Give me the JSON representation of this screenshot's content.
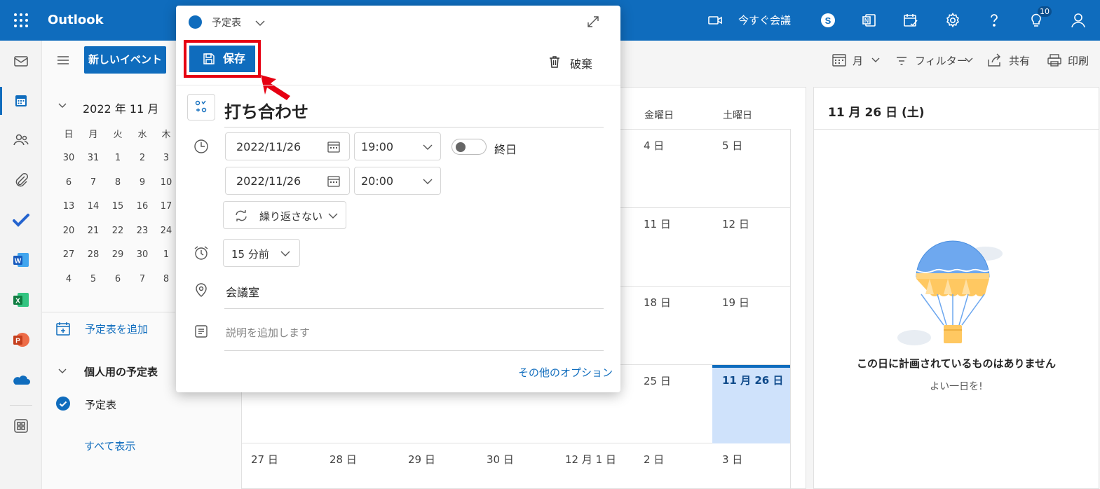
{
  "app": {
    "name": "Outlook"
  },
  "topbar": {
    "meet_now": "今すぐ会議",
    "notification_count": "10"
  },
  "toolbar": {
    "new_event": "新しいイベント",
    "view": "月",
    "filter": "フィルター",
    "share": "共有",
    "print": "印刷"
  },
  "mini_calendar": {
    "month": "2022 年 11 月",
    "weekdays": [
      "日",
      "月",
      "火",
      "水",
      "木"
    ],
    "weeks": [
      [
        "30",
        "31",
        "1",
        "2",
        "3"
      ],
      [
        "6",
        "7",
        "8",
        "9",
        "10"
      ],
      [
        "13",
        "14",
        "15",
        "16",
        "17"
      ],
      [
        "20",
        "21",
        "22",
        "23",
        "24"
      ],
      [
        "27",
        "28",
        "29",
        "30",
        "1"
      ],
      [
        "4",
        "5",
        "6",
        "7",
        "8"
      ]
    ]
  },
  "left_pane": {
    "add_calendar": "予定表を追加",
    "my_calendars": "個人用の予定表",
    "calendar_item": "予定表",
    "show_all": "すべて表示"
  },
  "grid": {
    "day_headers": {
      "fri": "金曜日",
      "sat": "土曜日"
    },
    "rows": [
      {
        "fri": "4 日",
        "sat": "5 日"
      },
      {
        "fri": "11 日",
        "sat": "12 日"
      },
      {
        "fri": "18 日",
        "sat": "19 日"
      },
      {
        "fri": "25 日",
        "sat": "11 月 26 日"
      }
    ],
    "last_row": [
      "27 日",
      "28 日",
      "29 日",
      "30 日",
      "12 月 1 日",
      "2 日",
      "3 日"
    ]
  },
  "right_panel": {
    "date": "11 月 26 日 (土)",
    "empty_title": "この日に計画されているものはありません",
    "empty_subtitle": "よい一日を!"
  },
  "popup": {
    "calendar": "予定表",
    "save": "保存",
    "discard": "破棄",
    "title": "打ち合わせ",
    "start_date": "2022/11/26",
    "start_time": "19:00",
    "end_date": "2022/11/26",
    "end_time": "20:00",
    "all_day": "終日",
    "all_day_on": false,
    "repeat": "繰り返さない",
    "reminder": "15 分前",
    "location": "会議室",
    "description_placeholder": "説明を追加します",
    "more_options": "その他のオプション"
  },
  "colors": {
    "brand": "#0f6cbd",
    "highlight": "#e60012",
    "today_bg": "#cfe2fb"
  }
}
